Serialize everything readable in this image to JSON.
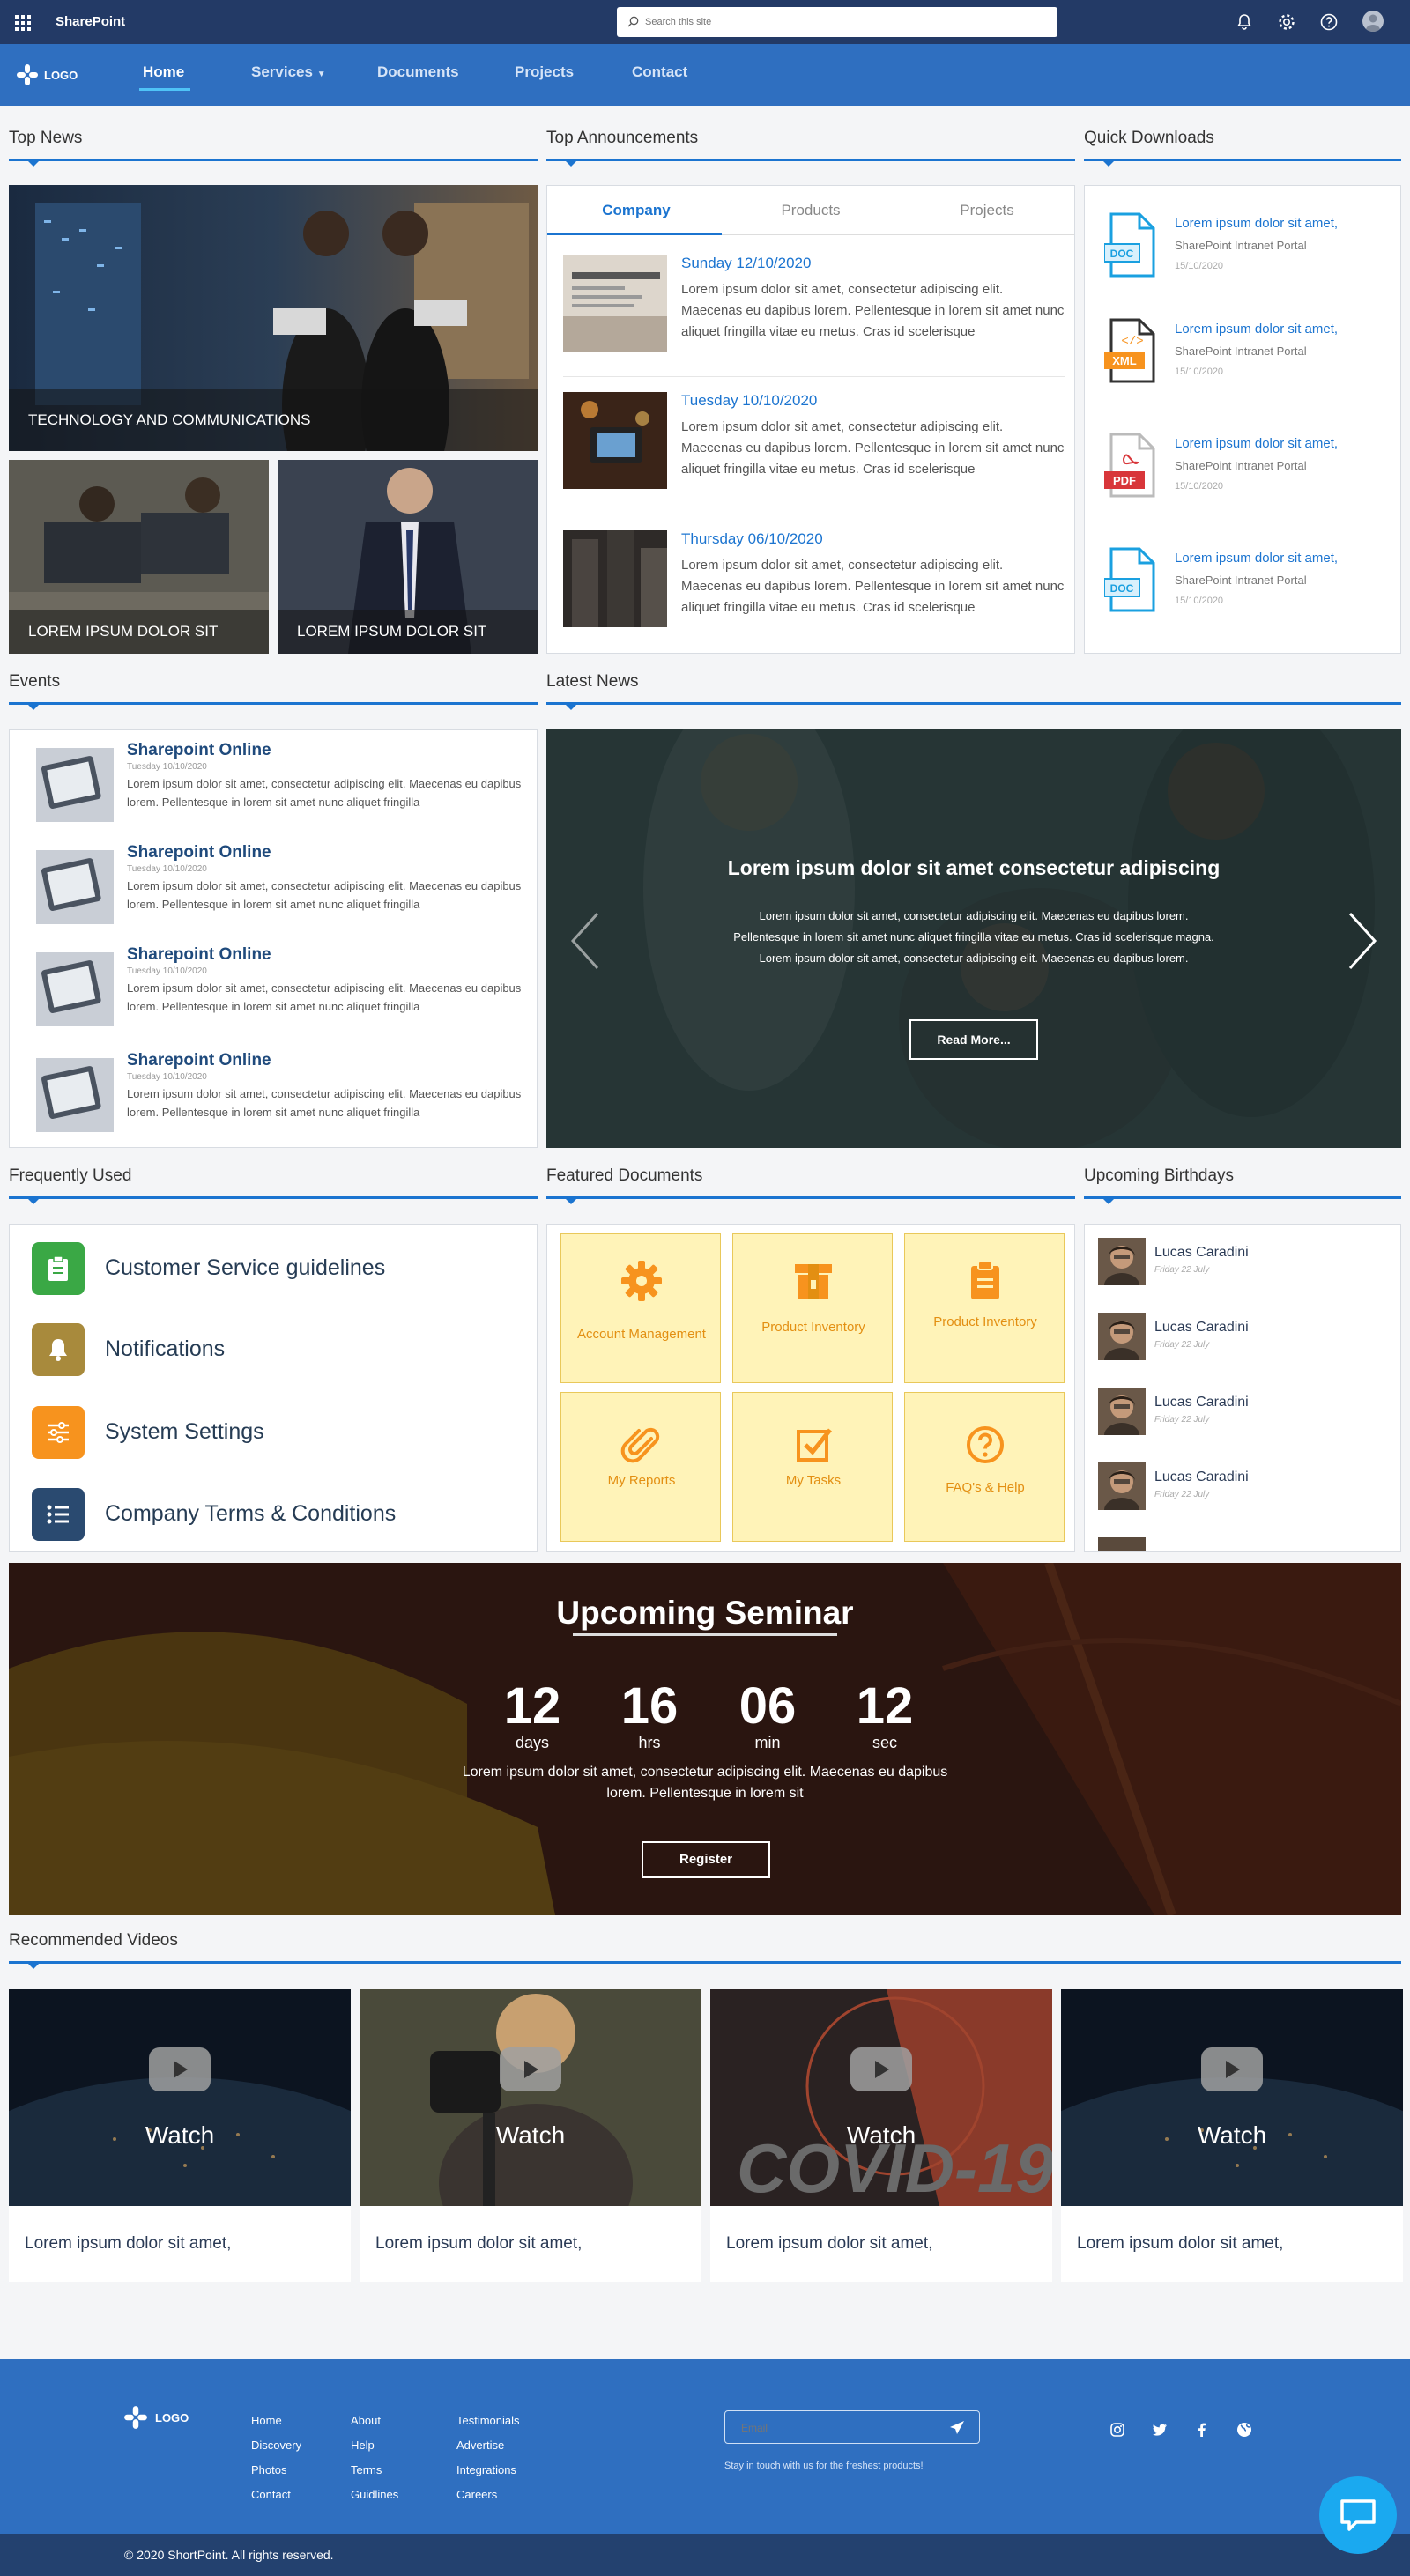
{
  "suite": {
    "app_name": "SharePoint",
    "search_placeholder": "Search this site"
  },
  "nav": {
    "logo": "LOGO",
    "items": [
      "Home",
      "Services",
      "Documents",
      "Projects",
      "Contact"
    ]
  },
  "sections": {
    "top_news": "Top News",
    "top_announcements": "Top Announcements",
    "quick_downloads": "Quick Downloads",
    "events": "Events",
    "latest_news": "Latest News",
    "frequently_used": "Frequently Used",
    "featured_documents": "Featured Documents",
    "upcoming_birthdays": "Upcoming Birthdays",
    "recommended_videos": "Recommended Videos"
  },
  "top_news": {
    "main_caption": "TECHNOLOGY AND COMMUNICATIONS",
    "sub_captions": [
      "LOREM IPSUM DOLOR SIT",
      "LOREM IPSUM DOLOR SIT"
    ]
  },
  "announcements": {
    "tabs": [
      "Company",
      "Products",
      "Projects"
    ],
    "items": [
      {
        "date": "Sunday 12/10/2020",
        "text": "Lorem ipsum dolor sit amet, consectetur adipiscing elit. Maecenas eu dapibus lorem. Pellentesque in lorem sit amet nunc aliquet fringilla vitae eu metus. Cras id scelerisque"
      },
      {
        "date": "Tuesday 10/10/2020",
        "text": "Lorem ipsum dolor sit amet, consectetur adipiscing elit. Maecenas eu dapibus lorem. Pellentesque in lorem sit amet nunc aliquet fringilla vitae eu metus. Cras id scelerisque"
      },
      {
        "date": "Thursday 06/10/2020",
        "text": "Lorem ipsum dolor sit amet, consectetur adipiscing elit. Maecenas eu dapibus lorem. Pellentesque in lorem sit amet nunc aliquet fringilla vitae eu metus. Cras id scelerisque"
      }
    ]
  },
  "downloads": [
    {
      "type": "DOC",
      "title": "Lorem ipsum dolor sit amet,",
      "source": "SharePoint Intranet Portal",
      "date": "15/10/2020"
    },
    {
      "type": "XML",
      "title": "Lorem ipsum dolor sit amet,",
      "source": "SharePoint Intranet Portal",
      "date": "15/10/2020"
    },
    {
      "type": "PDF",
      "title": "Lorem ipsum dolor sit amet,",
      "source": "SharePoint Intranet Portal",
      "date": "15/10/2020"
    },
    {
      "type": "DOC",
      "title": "Lorem ipsum dolor sit amet,",
      "source": "SharePoint Intranet Portal",
      "date": "15/10/2020"
    }
  ],
  "events": [
    {
      "title": "Sharepoint Online",
      "date": "Tuesday 10/10/2020",
      "text": "Lorem ipsum dolor sit amet, consectetur adipiscing elit. Maecenas eu dapibus lorem. Pellentesque in lorem sit amet nunc aliquet fringilla"
    },
    {
      "title": "Sharepoint Online",
      "date": "Tuesday 10/10/2020",
      "text": "Lorem ipsum dolor sit amet, consectetur adipiscing elit. Maecenas eu dapibus lorem. Pellentesque in lorem sit amet nunc aliquet fringilla"
    },
    {
      "title": "Sharepoint Online",
      "date": "Tuesday 10/10/2020",
      "text": "Lorem ipsum dolor sit amet, consectetur adipiscing elit. Maecenas eu dapibus lorem. Pellentesque in lorem sit amet nunc aliquet fringilla"
    },
    {
      "title": "Sharepoint Online",
      "date": "Tuesday 10/10/2020",
      "text": "Lorem ipsum dolor sit amet, consectetur adipiscing elit. Maecenas eu dapibus lorem. Pellentesque in lorem sit amet nunc aliquet fringilla"
    }
  ],
  "latest_news": {
    "title": "Lorem ipsum dolor sit amet consectetur adipiscing",
    "text": "Lorem ipsum dolor sit amet, consectetur adipiscing elit. Maecenas eu dapibus lorem. Pellentesque in lorem sit amet nunc aliquet fringilla vitae eu metus. Cras id scelerisque magna. Lorem ipsum dolor sit amet, consectetur adipiscing elit. Maecenas eu dapibus lorem.",
    "button": "Read More..."
  },
  "frequently_used": [
    {
      "label": "Customer Service guidelines",
      "color": "#3aa845",
      "icon": "clipboard-icon"
    },
    {
      "label": "Notifications",
      "color": "#a88a3c",
      "icon": "bell-icon"
    },
    {
      "label": "System Settings",
      "color": "#f7931e",
      "icon": "sliders-icon"
    },
    {
      "label": "Company Terms & Conditions",
      "color": "#2a4a70",
      "icon": "list-icon"
    }
  ],
  "featured_documents": [
    {
      "label": "Account Management",
      "icon": "gear-icon"
    },
    {
      "label": "Product Inventory",
      "icon": "box-icon"
    },
    {
      "label": "Product Inventory",
      "icon": "clipboard-icon"
    },
    {
      "label": "My Reports",
      "icon": "paperclip-icon"
    },
    {
      "label": "My Tasks",
      "icon": "checkbox-icon"
    },
    {
      "label": "FAQ's & Help",
      "icon": "question-icon"
    }
  ],
  "birthdays": [
    {
      "name": "Lucas Caradini",
      "date": "Friday 22 July"
    },
    {
      "name": "Lucas Caradini",
      "date": "Friday 22 July"
    },
    {
      "name": "Lucas Caradini",
      "date": "Friday 22 July"
    },
    {
      "name": "Lucas Caradini",
      "date": "Friday 22 July"
    }
  ],
  "seminar": {
    "title": "Upcoming Seminar",
    "countdown": [
      {
        "value": "12",
        "unit": "days"
      },
      {
        "value": "16",
        "unit": "hrs"
      },
      {
        "value": "06",
        "unit": "min"
      },
      {
        "value": "12",
        "unit": "sec"
      }
    ],
    "text": "Lorem ipsum dolor sit amet, consectetur adipiscing elit. Maecenas eu dapibus lorem. Pellentesque in lorem sit",
    "button": "Register"
  },
  "videos": [
    {
      "watch": "Watch",
      "caption": "Lorem ipsum dolor sit amet,"
    },
    {
      "watch": "Watch",
      "caption": "Lorem ipsum dolor sit amet,"
    },
    {
      "watch": "Watch",
      "caption": "Lorem ipsum dolor sit amet,"
    },
    {
      "watch": "Watch",
      "caption": "Lorem ipsum dolor sit amet,"
    }
  ],
  "footer": {
    "logo": "LOGO",
    "col1": [
      "Home",
      "Discovery",
      "Photos",
      "Contact"
    ],
    "col2": [
      "About",
      "Help",
      "Terms",
      "Guidlines"
    ],
    "col3": [
      "Testimonials",
      "Advertise",
      "Integrations",
      "Careers"
    ],
    "email_placeholder": "Email",
    "tagline": "Stay in touch with us for the freshest products!",
    "copyright": "© 2020 ShortPoint. All rights reserved."
  },
  "colors": {
    "accent": "#1b74d0",
    "nav": "#2f6fc0",
    "suite": "#233a66",
    "tile_bg": "#fff3b8",
    "tile_fg": "#e38f12"
  }
}
